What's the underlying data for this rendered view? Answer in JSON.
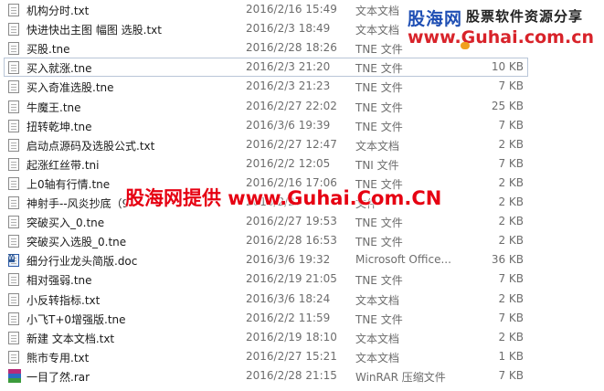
{
  "files": [
    {
      "name": "机构分时.txt",
      "date": "2016/2/16 15:49",
      "type": "文本文档",
      "size": "",
      "icon": "text-file-icon"
    },
    {
      "name": "快进快出主图 幅图 选股.txt",
      "date": "2016/2/3 18:49",
      "type": "文本文档",
      "size": "",
      "icon": "text-file-icon"
    },
    {
      "name": "买股.tne",
      "date": "2016/2/28 18:26",
      "type": "TNE 文件",
      "size": "",
      "icon": "text-file-icon"
    },
    {
      "name": "买入就涨.tne",
      "date": "2016/2/3 21:20",
      "type": "TNE 文件",
      "size": "10 KB",
      "icon": "text-file-icon"
    },
    {
      "name": "买入奇准选股.tne",
      "date": "2016/2/3 21:23",
      "type": "TNE 文件",
      "size": "7 KB",
      "icon": "text-file-icon"
    },
    {
      "name": "牛魔王.tne",
      "date": "2016/2/27 22:02",
      "type": "TNE 文件",
      "size": "25 KB",
      "icon": "text-file-icon"
    },
    {
      "name": "扭转乾坤.tne",
      "date": "2016/3/6 19:39",
      "type": "TNE 文件",
      "size": "7 KB",
      "icon": "text-file-icon"
    },
    {
      "name": "启动点源码及选股公式.txt",
      "date": "2016/2/27 12:47",
      "type": "文本文档",
      "size": "2 KB",
      "icon": "text-file-icon"
    },
    {
      "name": "起涨红丝带.tni",
      "date": "2016/2/2 12:05",
      "type": "TNI 文件",
      "size": "7 KB",
      "icon": "text-file-icon"
    },
    {
      "name": "上0轴有行情.tne",
      "date": "2016/2/16 17:06",
      "type": "TNE 文件",
      "size": "2 KB",
      "icon": "text-file-icon"
    },
    {
      "name": "神射手--风炎抄底（9",
      "date": "2016/2/27",
      "type": "文件",
      "size": "2 KB",
      "icon": "text-file-icon"
    },
    {
      "name": "突破买入_0.tne",
      "date": "2016/2/27 19:53",
      "type": "TNE 文件",
      "size": "2 KB",
      "icon": "text-file-icon"
    },
    {
      "name": "突破买入选股_0.tne",
      "date": "2016/2/28 16:53",
      "type": "TNE 文件",
      "size": "2 KB",
      "icon": "text-file-icon"
    },
    {
      "name": "细分行业龙头简版.doc",
      "date": "2016/3/6 19:32",
      "type": "Microsoft Office...",
      "size": "36 KB",
      "icon": "word-doc-icon"
    },
    {
      "name": "相对强弱.tne",
      "date": "2016/2/19 21:05",
      "type": "TNE 文件",
      "size": "7 KB",
      "icon": "text-file-icon"
    },
    {
      "name": "小反转指标.txt",
      "date": "2016/3/6 18:24",
      "type": "文本文档",
      "size": "2 KB",
      "icon": "text-file-icon"
    },
    {
      "name": "小飞T+0增强版.tne",
      "date": "2016/2/2 11:59",
      "type": "TNE 文件",
      "size": "7 KB",
      "icon": "text-file-icon"
    },
    {
      "name": "新建 文本文档.txt",
      "date": "2016/2/19 18:10",
      "type": "文本文档",
      "size": "2 KB",
      "icon": "text-file-icon"
    },
    {
      "name": "熊市专用.txt",
      "date": "2016/2/27 15:21",
      "type": "文本文档",
      "size": "1 KB",
      "icon": "text-file-icon"
    },
    {
      "name": "一目了然.rar",
      "date": "2016/2/28 21:15",
      "type": "WinRAR 压缩文件",
      "size": "7 KB",
      "icon": "rar-archive-icon"
    }
  ],
  "focused_index": 3,
  "watermark_top": {
    "brand": "股海网",
    "slogan": "股票软件资源分享",
    "site": "www.Guhai.com.cn"
  },
  "watermark_center": "股海网提供 www.Guhai.Com.CN",
  "colors": {
    "watermark_red": "#e60012",
    "watermark_blue": "#1f4fb4",
    "focus_border": "#b9c6d8"
  }
}
